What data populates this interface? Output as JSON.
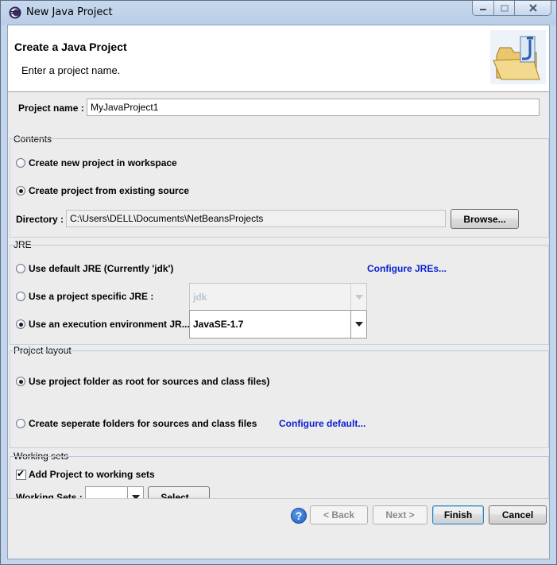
{
  "window": {
    "title": "New Java Project",
    "icon": "eclipse-icon",
    "controls": [
      "minimize-icon",
      "maximize-icon",
      "close-icon"
    ]
  },
  "header": {
    "title": "Create a Java Project",
    "message": "Enter a project name.",
    "banner_icon": "java-folder-wizard-icon"
  },
  "project_name": {
    "label": "Project name :",
    "value": "MyJavaProject1"
  },
  "contents": {
    "title": "Contents",
    "option_new": "Create new project in workspace",
    "option_existing": "Create project from existing source",
    "selected": "existing",
    "directory_label": "Directory :",
    "directory_value": "C:\\Users\\DELL\\Documents\\NetBeansProjects",
    "browse_label": "Browse..."
  },
  "jre": {
    "title": "JRE",
    "option_default": "Use default JRE (Currently 'jdk')",
    "configure_link": "Configure JREs...",
    "option_specific": "Use a project specific JRE :",
    "specific_value": "jdk",
    "option_env": "Use an execution environment JR...",
    "env_value": "JavaSE-1.7",
    "selected": "env"
  },
  "layout": {
    "title": "Project layout",
    "option_root": "Use project folder as root for sources and class files)",
    "option_separate": "Create seperate folders for sources and class files",
    "configure_link": "Configure default...",
    "selected": "root"
  },
  "working_sets": {
    "title": "Working sets",
    "checkbox_label": "Add Project to working sets",
    "checked": true,
    "sets_label": "Working Sets :",
    "select_label": "Select..."
  },
  "buttons": {
    "help": "?",
    "back": "< Back",
    "next": "Next >",
    "finish": "Finish",
    "cancel": "Cancel"
  },
  "colors": {
    "link": "#0a1ed4",
    "titlebar": "#c8d9ee"
  }
}
